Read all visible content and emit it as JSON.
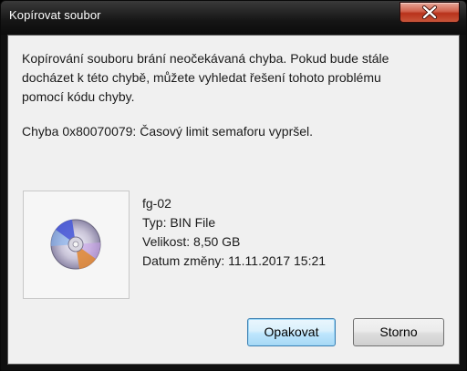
{
  "window": {
    "title": "Kopírovat soubor",
    "close_icon": "close-icon"
  },
  "message": {
    "line1": "Kopírování souboru brání neočekávaná chyba. Pokud bude stále",
    "line2": "docházet k této chybě, můžete vyhledat řešení tohoto problému",
    "line3": "pomocí kódu chyby.",
    "error": "Chyba 0x80070079: Časový limit semaforu vypršel."
  },
  "file": {
    "icon": "disc-image-icon",
    "name": "fg-02",
    "type": "Typ: BIN File",
    "size": "Velikost: 8,50 GB",
    "modified": "Datum změny: 11.11.2017 15:21"
  },
  "buttons": {
    "retry": "Opakovat",
    "cancel": "Storno"
  },
  "colors": {
    "close_button": "#c9553a",
    "primary_button_border": "#3c7fb1"
  }
}
